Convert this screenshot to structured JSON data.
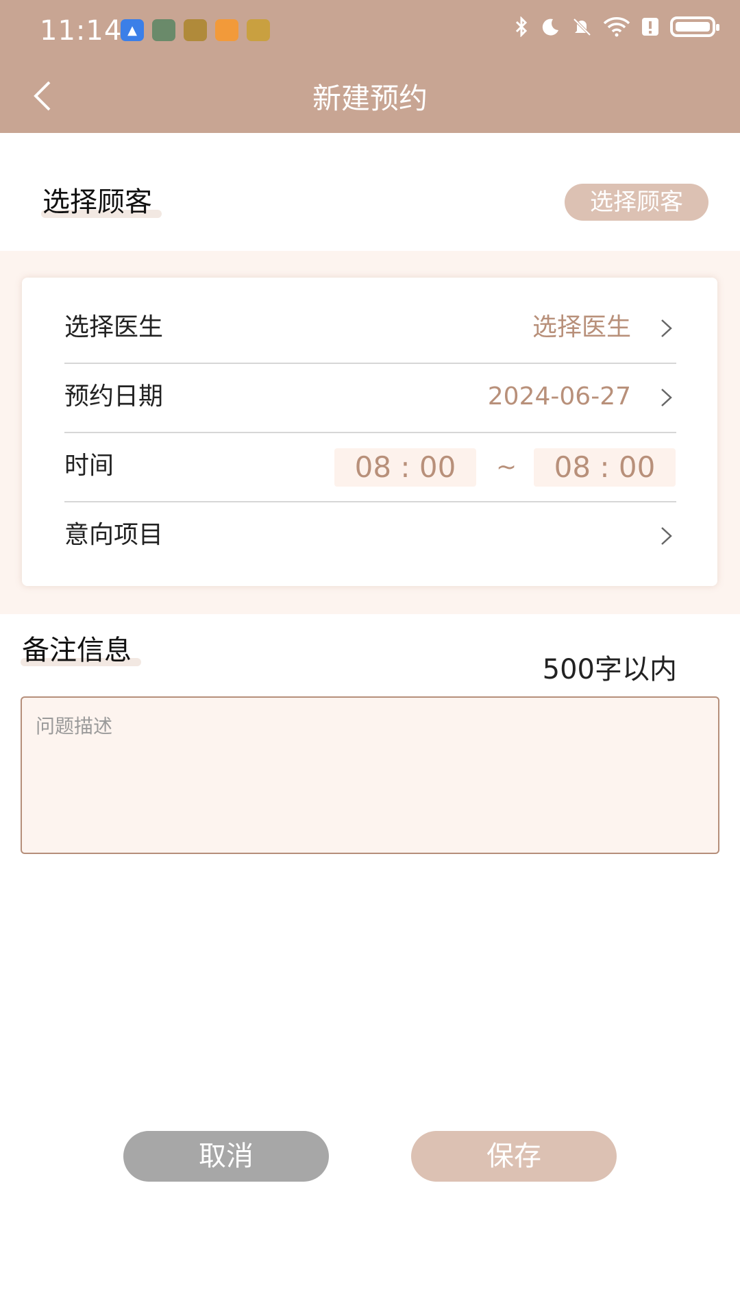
{
  "status_bar": {
    "time": "11:14"
  },
  "header": {
    "title": "新建预约"
  },
  "customer": {
    "section_title": "选择顾客",
    "button_label": "选择顾客"
  },
  "form": {
    "doctor": {
      "label": "选择医生",
      "value": "选择医生"
    },
    "date": {
      "label": "预约日期",
      "value": "2024-06-27"
    },
    "time": {
      "label": "时间",
      "start": "08 : 00",
      "separator": "~",
      "end": "08 : 00"
    },
    "project": {
      "label": "意向项目",
      "value": ""
    }
  },
  "remarks": {
    "section_title": "备注信息",
    "limit_text": "500字以内",
    "placeholder": "问题描述",
    "value": ""
  },
  "actions": {
    "cancel_label": "取消",
    "save_label": "保存"
  },
  "colors": {
    "header_bg": "#c8a593",
    "accent_text": "#b8907a",
    "band_bg": "#fdf4ef",
    "cancel_bg": "#a7a7a7",
    "save_bg": "#dcc1b3"
  },
  "icons": {
    "back": "chevron-left-icon",
    "row_arrow": "chevron-right-icon"
  }
}
